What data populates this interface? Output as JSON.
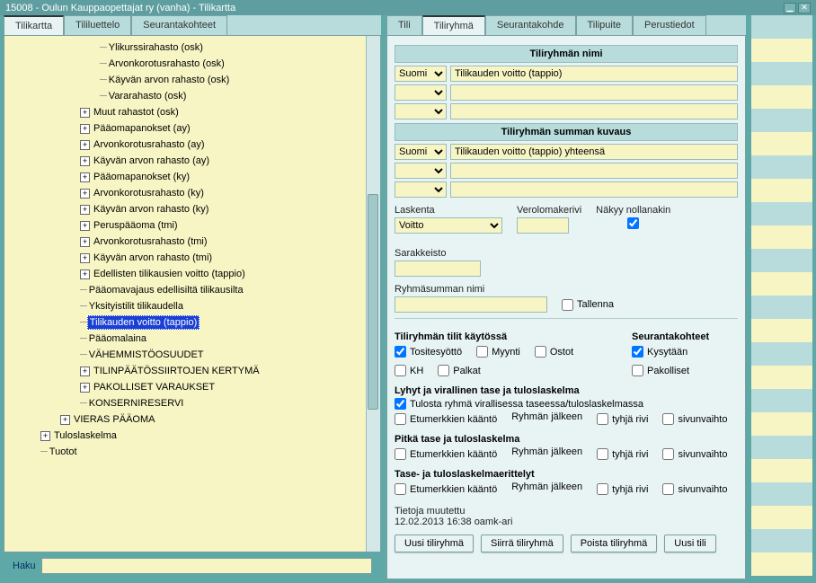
{
  "titlebar": {
    "text": "15008 - Oulun Kauppaopettajat ry (vanha) - Tilikartta"
  },
  "left_tabs": [
    "Tilikartta",
    "Tililuettelo",
    "Seurantakohteet"
  ],
  "left_tabs_active": 0,
  "right_tabs": [
    "Tili",
    "Tiliryhmä",
    "Seurantakohde",
    "Tilipuite",
    "Perustiedot"
  ],
  "right_tabs_active": 1,
  "tree": [
    {
      "depth": 3,
      "exp": null,
      "label": "Ylikurssirahasto (osk)"
    },
    {
      "depth": 3,
      "exp": null,
      "label": "Arvonkorotusrahasto (osk)"
    },
    {
      "depth": 3,
      "exp": null,
      "label": "Käyvän arvon rahasto (osk)"
    },
    {
      "depth": 3,
      "exp": null,
      "label": "Vararahasto (osk)"
    },
    {
      "depth": 2,
      "exp": "plus",
      "label": "Muut rahastot (osk)"
    },
    {
      "depth": 2,
      "exp": "plus",
      "label": "Pääomapanokset (ay)"
    },
    {
      "depth": 2,
      "exp": "plus",
      "label": "Arvonkorotusrahasto (ay)"
    },
    {
      "depth": 2,
      "exp": "plus",
      "label": "Käyvän arvon rahasto (ay)"
    },
    {
      "depth": 2,
      "exp": "plus",
      "label": "Pääomapanokset (ky)"
    },
    {
      "depth": 2,
      "exp": "plus",
      "label": "Arvonkorotusrahasto (ky)"
    },
    {
      "depth": 2,
      "exp": "plus",
      "label": "Käyvän arvon rahasto (ky)"
    },
    {
      "depth": 2,
      "exp": "plus",
      "label": "Peruspääoma (tmi)"
    },
    {
      "depth": 2,
      "exp": "plus",
      "label": "Arvonkorotusrahasto (tmi)"
    },
    {
      "depth": 2,
      "exp": "plus",
      "label": "Käyvän arvon rahasto (tmi)"
    },
    {
      "depth": 2,
      "exp": "plus",
      "label": "Edellisten tilikausien voitto (tappio)"
    },
    {
      "depth": 2,
      "exp": null,
      "label": "Pääomavajaus edellisiltä tilikausilta"
    },
    {
      "depth": 2,
      "exp": null,
      "label": "Yksityistilit tilikaudella"
    },
    {
      "depth": 2,
      "exp": null,
      "label": "Tilikauden voitto (tappio)",
      "selected": true
    },
    {
      "depth": 2,
      "exp": null,
      "label": "Pääomalaina"
    },
    {
      "depth": 2,
      "exp": null,
      "label": "VÄHEMMISTÖOSUUDET"
    },
    {
      "depth": 2,
      "exp": "plus",
      "label": "TILINPÄÄTÖSSIIRTOJEN KERTYMÄ"
    },
    {
      "depth": 2,
      "exp": "plus",
      "label": "PAKOLLISET VARAUKSET"
    },
    {
      "depth": 2,
      "exp": null,
      "label": "KONSERNIRESERVI"
    },
    {
      "depth": 1,
      "exp": "plus",
      "label": "VIERAS PÄÄOMA"
    },
    {
      "depth": 0,
      "exp": "plus",
      "label": "Tuloslaskelma"
    },
    {
      "depth": 0,
      "exp": null,
      "label": "Tuotot"
    }
  ],
  "search_label": "Haku",
  "sections": {
    "name_header": "Tiliryhmän nimi",
    "sum_header": "Tiliryhmän summan kuvaus"
  },
  "name_rows": [
    {
      "lang": "Suomi",
      "value": "Tilikauden voitto (tappio)"
    },
    {
      "lang": "",
      "value": ""
    },
    {
      "lang": "",
      "value": ""
    }
  ],
  "sum_rows": [
    {
      "lang": "Suomi",
      "value": "Tilikauden voitto (tappio) yhteensä"
    },
    {
      "lang": "",
      "value": ""
    },
    {
      "lang": "",
      "value": ""
    }
  ],
  "calc": {
    "laskenta_label": "Laskenta",
    "laskenta_value": "Voitto",
    "verolomake_label": "Verolomakerivi",
    "nakyy_label": "Näkyy nollanakin",
    "nakyy_checked": true,
    "sarakkeisto_label": "Sarakkeisto"
  },
  "ryhmasumma": {
    "label": "Ryhmäsumman nimi",
    "tallenna": "Tallenna",
    "tallenna_checked": false
  },
  "tilit": {
    "title": "Tiliryhmän tilit käytössä",
    "items": [
      {
        "label": "Tositesyöttö",
        "checked": true
      },
      {
        "label": "Myynti",
        "checked": false
      },
      {
        "label": "Ostot",
        "checked": false
      },
      {
        "label": "KH",
        "checked": false
      },
      {
        "label": "Palkat",
        "checked": false
      }
    ]
  },
  "seuranta": {
    "title": "Seurantakohteet",
    "items": [
      {
        "label": "Kysytään",
        "checked": true
      },
      {
        "label": "Pakolliset",
        "checked": false
      }
    ]
  },
  "lyhyt": {
    "title": "Lyhyt ja virallinen tase ja tuloslaskelma",
    "tulosta": "Tulosta ryhmä virallisessa taseessa/tuloslaskelmassa",
    "tulosta_checked": true,
    "etumerkki": "Etumerkkien kääntö",
    "jalkeen": "Ryhmän jälkeen",
    "tyhja": "tyhjä rivi",
    "sivu": "sivunvaihto"
  },
  "pitka": {
    "title": "Pitkä tase ja tuloslaskelma",
    "etumerkki": "Etumerkkien kääntö",
    "jalkeen": "Ryhmän jälkeen",
    "tyhja": "tyhjä rivi",
    "sivu": "sivunvaihto"
  },
  "erittely": {
    "title": "Tase- ja tuloslaskelmaerittelyt",
    "etumerkki": "Etumerkkien kääntö",
    "jalkeen": "Ryhmän jälkeen",
    "tyhja": "tyhjä rivi",
    "sivu": "sivunvaihto"
  },
  "muutettu": {
    "label": "Tietoja muutettu",
    "value": "12.02.2013 16:38 oamk-ari"
  },
  "buttons": {
    "uusi_ryhma": "Uusi tiliryhmä",
    "siirra": "Siirrä tiliryhmä",
    "poista": "Poista tiliryhmä",
    "uusi_tili": "Uusi tili"
  }
}
